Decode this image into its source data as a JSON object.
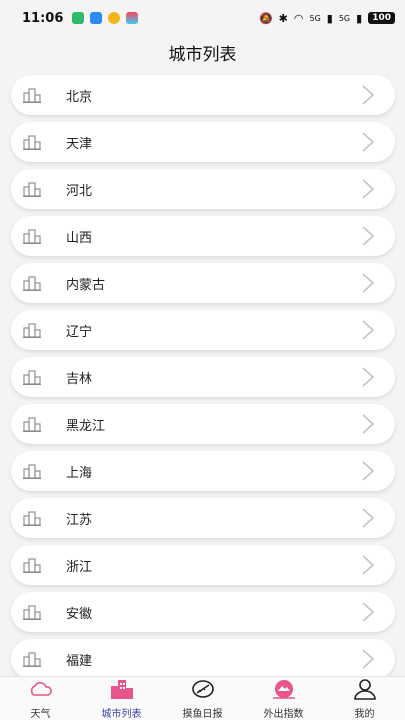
{
  "status": {
    "time": "11:06",
    "network1": "5G",
    "network2": "5G",
    "battery": "100"
  },
  "header": {
    "title": "城市列表"
  },
  "cities": [
    "北京",
    "天津",
    "河北",
    "山西",
    "内蒙古",
    "辽宁",
    "吉林",
    "黑龙江",
    "上海",
    "江苏",
    "浙江",
    "安徽",
    "福建"
  ],
  "tabs": [
    {
      "label": "天气",
      "icon": "cloud-icon"
    },
    {
      "label": "城市列表",
      "icon": "city-buildings-icon",
      "active": true
    },
    {
      "label": "摸鱼日报",
      "icon": "fish-report-icon"
    },
    {
      "label": "外出指数",
      "icon": "outdoor-index-icon"
    },
    {
      "label": "我的",
      "icon": "profile-icon"
    }
  ],
  "colors": {
    "accent": "#e8548c",
    "active_text": "#3a3fb0"
  }
}
